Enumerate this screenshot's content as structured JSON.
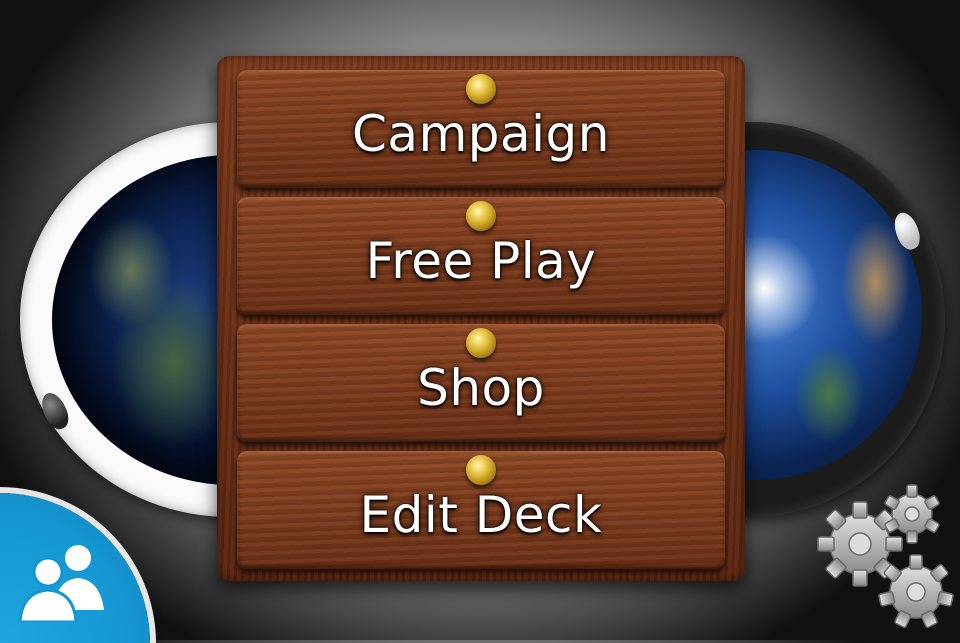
{
  "menu": {
    "items": [
      {
        "label": "Campaign"
      },
      {
        "label": "Free Play"
      },
      {
        "label": "Shop"
      },
      {
        "label": "Edit Deck"
      }
    ]
  },
  "icons": {
    "multiplayer": "two-users-icon",
    "settings": "gears-icon"
  },
  "colors": {
    "wood": "#7c3c1e",
    "pin_gold": "#e6c040",
    "multiplayer_blue": "#1596d2",
    "gear_gray": "#9a9a9a"
  }
}
